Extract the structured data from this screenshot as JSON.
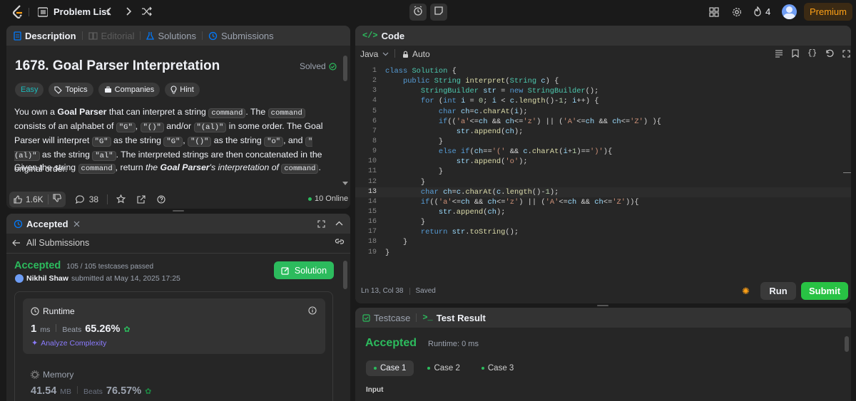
{
  "topbar": {
    "problem_list": "Problem List",
    "streak": "4",
    "premium": "Premium"
  },
  "desc_panel": {
    "tabs": [
      "Description",
      "Editorial",
      "Solutions",
      "Submissions"
    ],
    "title": "1678. Goal Parser Interpretation",
    "solved": "Solved",
    "tags": [
      "Easy",
      "Topics",
      "Companies",
      "Hint"
    ],
    "para1": {
      "t1": "You own a ",
      "b1": "Goal Parser",
      "t2": " that can interpret a string ",
      "c1": "command",
      "t3": ". The ",
      "c2": "command",
      "t4": " consists of an alphabet of ",
      "c3": "\"G\"",
      "t5": ", ",
      "c4": "\"()\"",
      "t6": " and/or ",
      "c5": "\"(al)\"",
      "t7": " in some order. The Goal Parser will interpret ",
      "c6": "\"G\"",
      "t8": " as the string ",
      "c7": "\"G\"",
      "t9": ", ",
      "c8": "\"()\"",
      "t10": " as the string ",
      "c9": "\"o\"",
      "t11": ", and ",
      "c10": "\"(al)\"",
      "t12": " as the string ",
      "c11": "\"al\"",
      "t13": ". The interpreted strings are then concatenated in the original order."
    },
    "para2": {
      "t1": "Given the string ",
      "c1": "command",
      "t2": ", return ",
      "i1": "the ",
      "bi": "Goal Parser",
      "i2": "'s interpretation of ",
      "c2": "command",
      "t3": "."
    },
    "footer": {
      "likes": "1.6K",
      "comments": "38",
      "online": "10 Online"
    }
  },
  "accepted_panel": {
    "tab": "Accepted",
    "all_submissions": "All Submissions",
    "status": "Accepted",
    "testcases": "105 / 105 testcases passed",
    "solution_btn": "Solution",
    "user": "Nikhil Shaw",
    "submitted": "submitted at May 14, 2025 17:25",
    "runtime_label": "Runtime",
    "runtime_val": "1",
    "runtime_unit": "ms",
    "beats_label": "Beats",
    "runtime_beats": "65.26%",
    "analyze": "Analyze Complexity",
    "memory_label": "Memory",
    "memory_val": "41.54",
    "memory_unit": "MB",
    "memory_beats": "76.57%"
  },
  "code_panel": {
    "title": "Code",
    "language": "Java",
    "mode": "Auto",
    "status": "Ln 13, Col 38",
    "saved": "Saved",
    "run": "Run",
    "submit": "Submit",
    "code_lines": [
      "class Solution {",
      "    public String interpret(String c) {",
      "        StringBuilder str = new StringBuilder();",
      "        for (int i = 0; i < c.length()-1; i++) {",
      "            char ch=c.charAt(i);",
      "            if(('a'<=ch && ch<='z') || ('A'<=ch && ch<='Z') ){",
      "                str.append(ch);",
      "            }",
      "            else if(ch=='(' && c.charAt(i+1)==')'){",
      "                str.append('o');",
      "            }",
      "        }",
      "        char ch=c.charAt(c.length()-1);",
      "        if(('a'<=ch && ch<='z') || ('A'<=ch && ch<='Z')){",
      "            str.append(ch);",
      "        }",
      "        return str.toString();",
      "    }",
      "}"
    ]
  },
  "result_panel": {
    "tabs": [
      "Testcase",
      "Test Result"
    ],
    "status": "Accepted",
    "runtime": "Runtime: 0 ms",
    "cases": [
      "Case 1",
      "Case 2",
      "Case 3"
    ],
    "input_label": "Input"
  },
  "colors": {
    "accent_green": "#2cbb5d",
    "orange": "#ffa116",
    "easy": "#1cbaba",
    "submit": "#28c244"
  }
}
